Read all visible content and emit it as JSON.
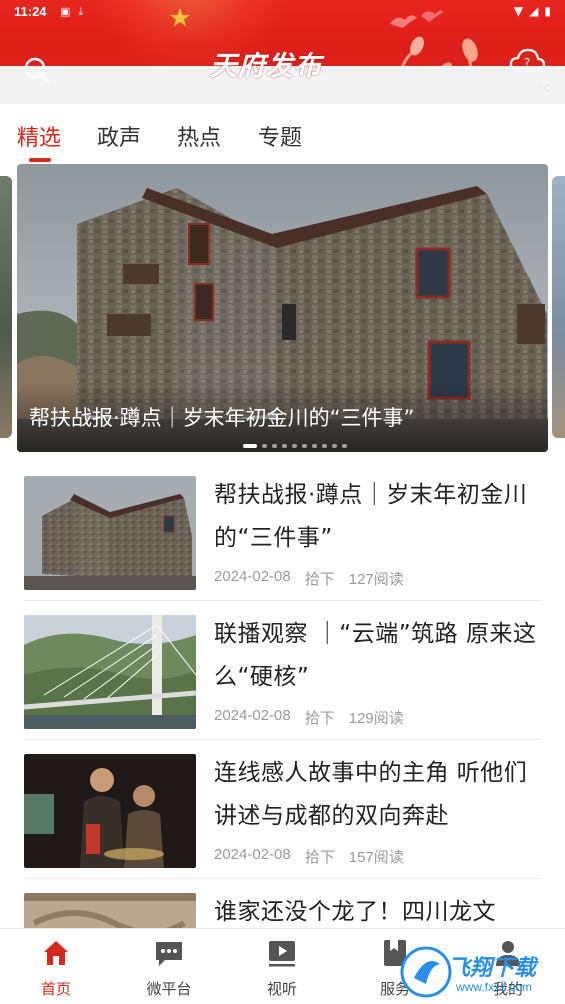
{
  "status_bar": {
    "time": "11:24",
    "left_icons": [
      "notification-icon",
      "download-icon"
    ],
    "right_icons": [
      "wifi-icon",
      "signal-icon",
      "battery-icon"
    ]
  },
  "header": {
    "logo_text": "天府发布",
    "weather_temp": "°C",
    "brand_color": "#d7281e"
  },
  "tabs": [
    {
      "label": "精选",
      "active": true
    },
    {
      "label": "政声",
      "active": false
    },
    {
      "label": "热点",
      "active": false
    },
    {
      "label": "专题",
      "active": false
    }
  ],
  "carousel": {
    "caption": "帮扶战报·蹲点｜岁末年初金川的“三件事”",
    "slide_count": 10,
    "active_index": 0
  },
  "news": [
    {
      "title": "帮扶战报·蹲点｜岁末年初金川的“三件事”",
      "date": "2024-02-08",
      "source": "拾下",
      "reads": "127阅读",
      "thumb": "stone-building"
    },
    {
      "title": "联播观察 ｜“云端”筑路 原来这么“硬核”",
      "date": "2024-02-08",
      "source": "拾下",
      "reads": "129阅读",
      "thumb": "bridge"
    },
    {
      "title": "连线感人故事中的主角 听他们讲述与成都的双向奔赴",
      "date": "2024-02-08",
      "source": "拾下",
      "reads": "157阅读",
      "thumb": "people"
    },
    {
      "title": "谁家还没个龙了！四川龙文",
      "date": "",
      "source": "",
      "reads": "",
      "thumb": "stone-carving"
    }
  ],
  "bottom_nav": [
    {
      "label": "首页",
      "icon": "home-icon",
      "active": true
    },
    {
      "label": "微平台",
      "icon": "chat-icon",
      "active": false
    },
    {
      "label": "视听",
      "icon": "play-icon",
      "active": false
    },
    {
      "label": "服务",
      "icon": "bookmark-icon",
      "active": false
    },
    {
      "label": "我的",
      "icon": "user-icon",
      "active": false
    }
  ],
  "watermark": {
    "text": "飞翔下载",
    "sub": "www.fxxz.com"
  }
}
